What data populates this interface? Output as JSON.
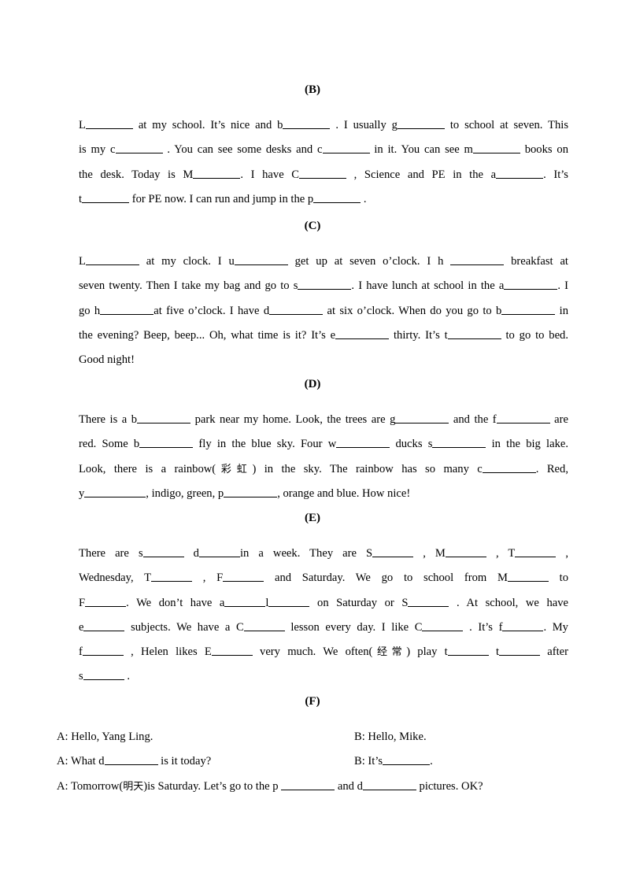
{
  "document": {
    "type": "worksheet",
    "language": "English / Chinese",
    "page_background": "#ffffff",
    "text_color": "#000000"
  },
  "sections": [
    {
      "id": "B",
      "heading": "(B)",
      "paragraph_runs": [
        "L",
        "BLANK",
        " at my school. It’s nice and b",
        "BLANK",
        " . I usually g",
        "BLANK",
        " to school at seven. This is my c",
        "BLANK",
        " . You can see some desks and c",
        "BLANK",
        " in it. You can see m",
        "BLANK",
        " books on the desk. Today is M",
        "BLANK",
        ". I have C",
        "BLANK",
        " , Science and PE in the a",
        "BLANK",
        ". It’s t",
        "BLANK",
        " for PE now. I can run and jump in the p",
        "BLANK",
        " ."
      ],
      "lines": [
        {
          "parts": [
            {
              "t": "text",
              "v": "L"
            },
            {
              "t": "blank",
              "w": "b-md"
            },
            {
              "t": "text",
              "v": " at my school. It’s nice and b"
            },
            {
              "t": "blank",
              "w": "b-md"
            },
            {
              "t": "text",
              "v": " . I usually g"
            },
            {
              "t": "blank",
              "w": "b-md"
            },
            {
              "t": "text",
              "v": " to school at seven. This"
            }
          ]
        },
        {
          "parts": [
            {
              "t": "text",
              "v": "is my c"
            },
            {
              "t": "blank",
              "w": "b-md"
            },
            {
              "t": "text",
              "v": " . You can see some desks and c"
            },
            {
              "t": "blank",
              "w": "b-md"
            },
            {
              "t": "text",
              "v": " in it. You can see m"
            },
            {
              "t": "blank",
              "w": "b-md"
            },
            {
              "t": "text",
              "v": " books on"
            }
          ]
        },
        {
          "parts": [
            {
              "t": "text",
              "v": "the desk. Today is M"
            },
            {
              "t": "blank",
              "w": "b-md"
            },
            {
              "t": "text",
              "v": ". I have C"
            },
            {
              "t": "blank",
              "w": "b-md"
            },
            {
              "t": "text",
              "v": " , Science and PE in the a"
            },
            {
              "t": "blank",
              "w": "b-md"
            },
            {
              "t": "text",
              "v": ". It’s"
            }
          ]
        },
        {
          "parts": [
            {
              "t": "text",
              "v": "t"
            },
            {
              "t": "blank",
              "w": "b-md"
            },
            {
              "t": "text",
              "v": " for PE now. I can run and jump in the p"
            },
            {
              "t": "blank",
              "w": "b-md"
            },
            {
              "t": "text",
              "v": " ."
            }
          ]
        }
      ]
    },
    {
      "id": "C",
      "heading": "(C)",
      "lines": [
        {
          "parts": [
            {
              "t": "text",
              "v": "L"
            },
            {
              "t": "blank",
              "w": "b-lg"
            },
            {
              "t": "text",
              "v": " at my clock. I u"
            },
            {
              "t": "blank",
              "w": "b-lg"
            },
            {
              "t": "text",
              "v": " get up at seven o’clock. I h "
            },
            {
              "t": "blank",
              "w": "b-lg"
            },
            {
              "t": "text",
              "v": " breakfast at"
            }
          ]
        },
        {
          "parts": [
            {
              "t": "text",
              "v": "seven twenty. Then I take my bag and go to s"
            },
            {
              "t": "blank",
              "w": "b-lg"
            },
            {
              "t": "text",
              "v": ". I have lunch at school in the a"
            },
            {
              "t": "blank",
              "w": "b-lg"
            },
            {
              "t": "text",
              "v": ". I"
            }
          ]
        },
        {
          "parts": [
            {
              "t": "text",
              "v": "go h"
            },
            {
              "t": "blank",
              "w": "b-lg"
            },
            {
              "t": "text",
              "v": "at five o’clock. I have d"
            },
            {
              "t": "blank",
              "w": "b-lg"
            },
            {
              "t": "text",
              "v": " at six o’clock. When do you go to b"
            },
            {
              "t": "blank",
              "w": "b-lg"
            },
            {
              "t": "text",
              "v": " in"
            }
          ]
        },
        {
          "parts": [
            {
              "t": "text",
              "v": "the evening? Beep, beep... Oh, what time is it? It’s e"
            },
            {
              "t": "blank",
              "w": "b-lg"
            },
            {
              "t": "text",
              "v": " thirty. It’s t"
            },
            {
              "t": "blank",
              "w": "b-lg"
            },
            {
              "t": "text",
              "v": " to go to bed."
            }
          ]
        },
        {
          "parts": [
            {
              "t": "text",
              "v": "Good night!"
            }
          ]
        }
      ]
    },
    {
      "id": "D",
      "heading": "(D)",
      "lines": [
        {
          "parts": [
            {
              "t": "text",
              "v": "There is a b"
            },
            {
              "t": "blank",
              "w": "b-lg"
            },
            {
              "t": "text",
              "v": " park near my home. Look, the trees are g"
            },
            {
              "t": "blank",
              "w": "b-lg"
            },
            {
              "t": "text",
              "v": " and the f"
            },
            {
              "t": "blank",
              "w": "b-lg"
            },
            {
              "t": "text",
              "v": " are"
            }
          ]
        },
        {
          "parts": [
            {
              "t": "text",
              "v": "red. Some b"
            },
            {
              "t": "blank",
              "w": "b-lg"
            },
            {
              "t": "text",
              "v": " fly in the blue sky. Four w"
            },
            {
              "t": "blank",
              "w": "b-lg"
            },
            {
              "t": "text",
              "v": " ducks s"
            },
            {
              "t": "blank",
              "w": "b-lg"
            },
            {
              "t": "text",
              "v": " in the big lake."
            }
          ]
        },
        {
          "parts": [
            {
              "t": "text",
              "v": "Look, there is a rainbow("
            },
            {
              "t": "cn",
              "v": "彩虹"
            },
            {
              "t": "text",
              "v": ") in the sky. The rainbow has so many c"
            },
            {
              "t": "blank",
              "w": "b-lg"
            },
            {
              "t": "text",
              "v": ". Red,"
            }
          ]
        },
        {
          "parts": [
            {
              "t": "text",
              "v": "y"
            },
            {
              "t": "blank",
              "w": "b-xl"
            },
            {
              "t": "text",
              "v": ", indigo, green, p"
            },
            {
              "t": "blank",
              "w": "b-lg"
            },
            {
              "t": "text",
              "v": ", orange and blue. How nice!"
            }
          ]
        }
      ]
    },
    {
      "id": "E",
      "heading": "(E)",
      "lines": [
        {
          "parts": [
            {
              "t": "text",
              "v": "There are s"
            },
            {
              "t": "blank",
              "w": "b-sm"
            },
            {
              "t": "text",
              "v": " d"
            },
            {
              "t": "blank",
              "w": "b-sm"
            },
            {
              "t": "text",
              "v": "in a week. They are S"
            },
            {
              "t": "blank",
              "w": "b-sm"
            },
            {
              "t": "text",
              "v": " , M"
            },
            {
              "t": "blank",
              "w": "b-sm"
            },
            {
              "t": "text",
              "v": " , T"
            },
            {
              "t": "blank",
              "w": "b-sm"
            },
            {
              "t": "text",
              "v": " ,"
            }
          ]
        },
        {
          "parts": [
            {
              "t": "text",
              "v": "Wednesday, T"
            },
            {
              "t": "blank",
              "w": "b-sm"
            },
            {
              "t": "text",
              "v": " , F"
            },
            {
              "t": "blank",
              "w": "b-sm"
            },
            {
              "t": "text",
              "v": " and Saturday. We go to school from M"
            },
            {
              "t": "blank",
              "w": "b-sm"
            },
            {
              "t": "text",
              "v": " to"
            }
          ]
        },
        {
          "parts": [
            {
              "t": "text",
              "v": "F"
            },
            {
              "t": "blank",
              "w": "b-sm"
            },
            {
              "t": "text",
              "v": ". We don’t have a"
            },
            {
              "t": "blank",
              "w": "b-sm"
            },
            {
              "t": "text",
              "v": "l"
            },
            {
              "t": "blank",
              "w": "b-sm"
            },
            {
              "t": "text",
              "v": " on Saturday or S"
            },
            {
              "t": "blank",
              "w": "b-sm"
            },
            {
              "t": "text",
              "v": " . At school, we have"
            }
          ]
        },
        {
          "parts": [
            {
              "t": "text",
              "v": "e"
            },
            {
              "t": "blank",
              "w": "b-sm"
            },
            {
              "t": "text",
              "v": " subjects. We have a C"
            },
            {
              "t": "blank",
              "w": "b-sm"
            },
            {
              "t": "text",
              "v": " lesson every day. I like C"
            },
            {
              "t": "blank",
              "w": "b-sm"
            },
            {
              "t": "text",
              "v": " . It’s f"
            },
            {
              "t": "blank",
              "w": "b-sm"
            },
            {
              "t": "text",
              "v": ". My"
            }
          ]
        },
        {
          "parts": [
            {
              "t": "text",
              "v": "f"
            },
            {
              "t": "blank",
              "w": "b-sm"
            },
            {
              "t": "text",
              "v": " , Helen likes E"
            },
            {
              "t": "blank",
              "w": "b-sm"
            },
            {
              "t": "text",
              "v": " very much. We often("
            },
            {
              "t": "cn",
              "v": "经常"
            },
            {
              "t": "text",
              "v": ") play t"
            },
            {
              "t": "blank",
              "w": "b-sm"
            },
            {
              "t": "text",
              "v": " t"
            },
            {
              "t": "blank",
              "w": "b-sm"
            },
            {
              "t": "text",
              "v": " after"
            }
          ]
        },
        {
          "parts": [
            {
              "t": "text",
              "v": "s"
            },
            {
              "t": "blank",
              "w": "b-sm"
            },
            {
              "t": "text",
              "v": " ."
            }
          ]
        }
      ]
    },
    {
      "id": "F",
      "heading": "(F)",
      "dialogue": [
        {
          "speaker_a": [
            {
              "t": "text",
              "v": "A: Hello, Yang Ling."
            }
          ],
          "speaker_b": [
            {
              "t": "text",
              "v": "B: Hello, Mike."
            }
          ]
        },
        {
          "speaker_a": [
            {
              "t": "text",
              "v": "A: What d"
            },
            {
              "t": "blank",
              "w": "b-lg"
            },
            {
              "t": "text",
              "v": " is it today?"
            }
          ],
          "speaker_b": [
            {
              "t": "text",
              "v": "B: It’s"
            },
            {
              "t": "blank",
              "w": "b-md"
            },
            {
              "t": "text",
              "v": "."
            }
          ]
        },
        {
          "full": [
            {
              "t": "text",
              "v": "A: Tomorrow("
            },
            {
              "t": "cn",
              "v": "明天"
            },
            {
              "t": "text",
              "v": ")is Saturday. Let’s go to the p "
            },
            {
              "t": "blank",
              "w": "b-lg"
            },
            {
              "t": "text",
              "v": " and d"
            },
            {
              "t": "blank",
              "w": "b-lg"
            },
            {
              "t": "text",
              "v": " pictures. OK?"
            }
          ]
        }
      ]
    }
  ]
}
